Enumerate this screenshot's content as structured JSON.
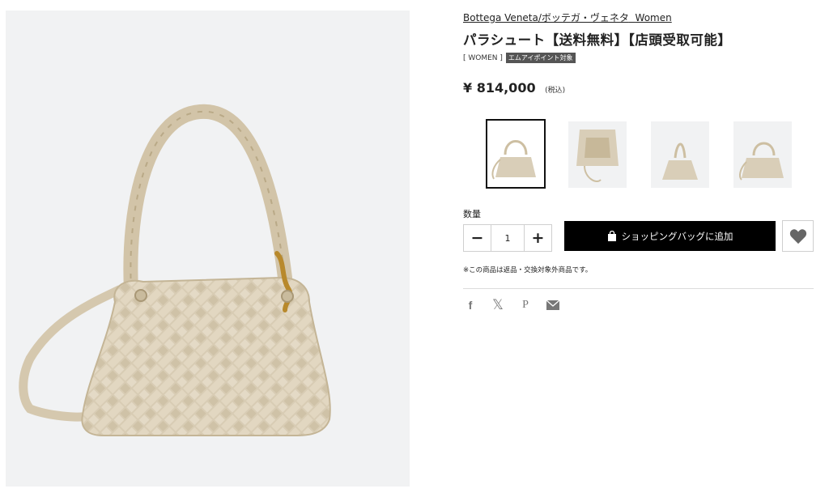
{
  "product": {
    "brand": "Bottega Veneta/ボッテガ・ヴェネタ",
    "brand_gender": "Women",
    "title": "パラシュート【送料無料】【店頭受取可能】",
    "category": "[ WOMEN ]",
    "badge": "エムアイポイント対象",
    "price": "¥ 814,000",
    "tax_note": "(税込)",
    "color_accent": "#000000"
  },
  "gallery": {
    "main_image": "bag-hero-image",
    "thumbnails": [
      {
        "name": "thumb-front",
        "selected": true
      },
      {
        "name": "thumb-inside",
        "selected": false
      },
      {
        "name": "thumb-side",
        "selected": false
      },
      {
        "name": "thumb-angle",
        "selected": false
      }
    ]
  },
  "purchase": {
    "qty_label": "数量",
    "minus": "−",
    "qty_value": "1",
    "plus": "+",
    "cart_button": "ショッピングバッグに追加",
    "favorite_icon": "heart-icon"
  },
  "notice": "※この商品は返品・交換対象外商品です。",
  "share": {
    "icons": [
      "facebook-icon",
      "x-icon",
      "pinterest-icon",
      "mail-icon"
    ],
    "facebook": "f",
    "x": "𝕏",
    "pinterest": "P"
  }
}
